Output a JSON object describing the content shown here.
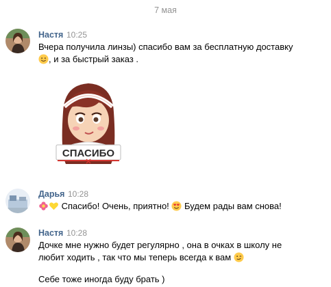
{
  "date_separator": "7 мая",
  "messages": [
    {
      "author": "Настя",
      "time": "10:25",
      "text_line1": "Вчера получила линзы) спасибо вам за бесплатную доставку",
      "text_line2_after_emoji": ", и за быстрый заказ .",
      "sticker_label": "СПАСИБО"
    },
    {
      "author": "Дарья",
      "time": "10:28",
      "text_seg1": "Спасибо! Очень, приятно!",
      "text_seg2": "Будем рады вам снова!"
    },
    {
      "author": "Настя",
      "time": "10:28",
      "text_line1": "Дочке мне нужно будет регулярно , она в очках в школу не",
      "text_line2": "любит ходить , так что мы теперь всегда к вам",
      "text_line3": "Себе тоже иногда буду брать )"
    }
  ],
  "colors": {
    "author": "#42648b",
    "muted": "#939393",
    "sticker_hair": "#7a2d22",
    "sticker_band": "#ffffff"
  },
  "icons": [
    "smile-emoji-icon",
    "flower-emoji-icon",
    "yellow-heart-emoji-icon",
    "heart-eyes-emoji-icon",
    "wink-emoji-icon"
  ]
}
